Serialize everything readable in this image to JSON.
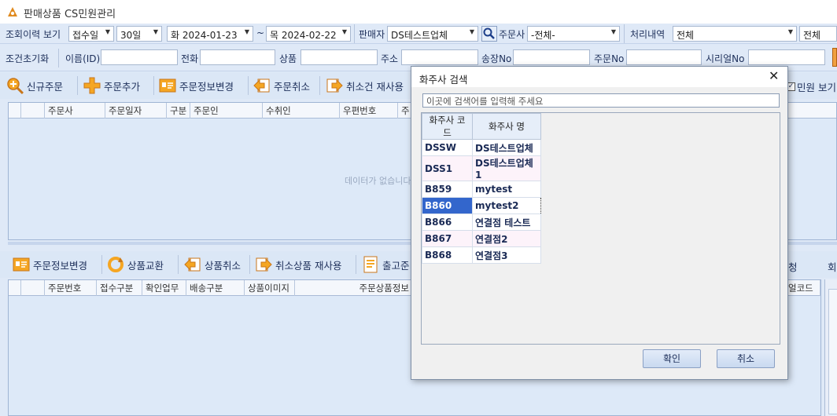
{
  "window": {
    "title": "판매상품 CS민원관리"
  },
  "filters": {
    "history_label": "조회이력 보기",
    "date_type": "접수일",
    "period": "30일",
    "date_from": "화 2024-01-23",
    "range_sep": "~",
    "date_to": "목 2024-02-22",
    "seller_label": "판매자",
    "seller_value": "DS테스트업체",
    "client_label": "주문사",
    "client_value": "-전체-",
    "process_label": "처리내역",
    "process_value": "전체",
    "extra_value": "전체"
  },
  "conditions": {
    "reset_label": "조건초기화",
    "name_label": "이름(ID)",
    "phone_label": "전화",
    "product_label": "상품",
    "address_label": "주소",
    "invoice_label": "송장No",
    "order_label": "주문No",
    "serial_label": "시리얼No"
  },
  "toolbar_top": {
    "new_order": "신규주문",
    "add_order": "주문추가",
    "change_info": "주문정보변경",
    "cancel_order": "주문취소",
    "reuse_cancel": "취소건 재사용",
    "cs_view": "민원 보기"
  },
  "grid_top": {
    "columns": [
      "주문사",
      "주문일자",
      "구분",
      "주문인",
      "수취인",
      "우편번호",
      "주"
    ],
    "empty_text": "데이터가 없습니다"
  },
  "toolbar_bottom": {
    "change_info": "주문정보변경",
    "exchange": "상품교환",
    "cancel_product": "상품취소",
    "reuse_product": "취소상품 재사용",
    "ship": "출고준",
    "right1": "청",
    "right2": "회"
  },
  "grid_bottom": {
    "columns": [
      "주문번호",
      "접수구분",
      "확인업무",
      "배송구분",
      "상품이미지",
      "주문상품정보"
    ],
    "right_col": "얼코드"
  },
  "dialog": {
    "title": "화주사 검색",
    "close": "✕",
    "search_placeholder": "이곳에 검색어를 입력해 주세요",
    "col_code": "화주사 코드",
    "col_name": "화주사 명",
    "rows": [
      {
        "code": "DSSW",
        "name": "DS테스트업체"
      },
      {
        "code": "DSS1",
        "name": "DS테스트업체1"
      },
      {
        "code": "B859",
        "name": "mytest"
      },
      {
        "code": "B860",
        "name": "mytest2"
      },
      {
        "code": "B866",
        "name": "연결점 테스트"
      },
      {
        "code": "B867",
        "name": "연결점2"
      },
      {
        "code": "B868",
        "name": "연결점3"
      }
    ],
    "selected_index": 3,
    "ok": "확인",
    "cancel": "취소"
  }
}
